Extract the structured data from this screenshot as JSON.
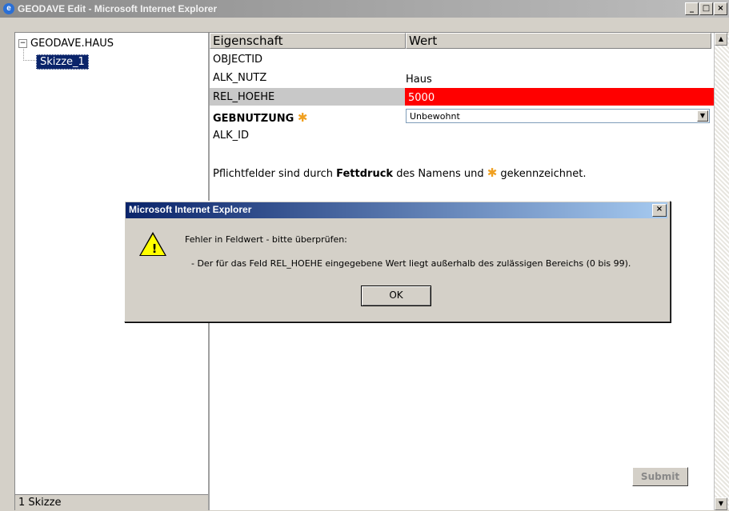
{
  "window": {
    "title": "GEODAVE Edit - Microsoft Internet Explorer",
    "minimize": "_",
    "maximize": "□",
    "close": "×"
  },
  "tree": {
    "root_label": "GEODAVE.HAUS",
    "expander": "−",
    "child_label": "Skizze_1",
    "status": "1 Skizze"
  },
  "table": {
    "header_property": "Eigenschaft",
    "header_value": "Wert",
    "rows": [
      {
        "name": "OBJECTID",
        "value": ""
      },
      {
        "name": "ALK_NUTZ",
        "value": "Haus"
      },
      {
        "name": "REL_HOEHE",
        "value": "5000"
      },
      {
        "name": "GEBNUTZUNG",
        "value": "Unbewohnt"
      },
      {
        "name": "ALK_ID",
        "value": ""
      }
    ],
    "required_marker": "✱"
  },
  "note": {
    "part1": "Pflichtfelder sind durch ",
    "bold": "Fettdruck",
    "part2": " des Namens und ",
    "part3": " gekennzeichnet."
  },
  "submit_label": "Submit",
  "dialog": {
    "title": "Microsoft Internet Explorer",
    "close": "×",
    "message_line1": "Fehler in Feldwert - bitte überprüfen:",
    "message_line2": "- Der für das Feld REL_HOEHE eingegebene Wert liegt außerhalb des zulässigen Bereichs (0 bis 99).",
    "ok_label": "OK"
  },
  "colors": {
    "error_field": "#ff0000",
    "selection": "#0a246a",
    "dialog_title": "#0a246a"
  }
}
